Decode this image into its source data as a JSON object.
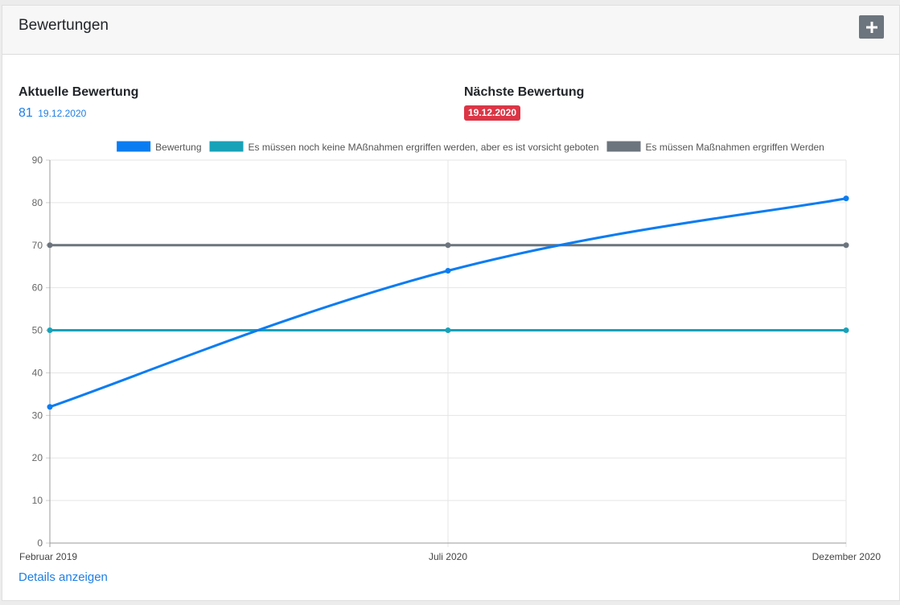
{
  "header": {
    "title": "Bewertungen",
    "add_icon": "plus-icon"
  },
  "current": {
    "label": "Aktuelle Bewertung",
    "value": "81",
    "date": "19.12.2020"
  },
  "next": {
    "label": "Nächste Bewertung",
    "date": "19.12.2020"
  },
  "footer": {
    "details_link": "Details anzeigen"
  },
  "colors": {
    "accent": "#1e7fe3",
    "danger": "#dc3545",
    "teal": "#17a2b8",
    "gray": "#6c757d"
  },
  "chart_data": {
    "type": "line",
    "categories": [
      "Februar 2019",
      "Juli 2020",
      "Dezember 2020"
    ],
    "ylim": [
      0,
      90
    ],
    "yticks": [
      0,
      10,
      20,
      30,
      40,
      50,
      60,
      70,
      80,
      90
    ],
    "grid": true,
    "legend_position": "top",
    "series": [
      {
        "name": "Bewertung",
        "values": [
          32,
          64,
          81
        ],
        "color": "#0a7cf2",
        "curved": true
      },
      {
        "name": "Es müssen noch keine MAßnahmen ergriffen werden, aber es ist vorsicht geboten",
        "values": [
          50,
          50,
          50
        ],
        "color": "#17a2b8"
      },
      {
        "name": "Es müssen Maßnahmen ergriffen Werden",
        "values": [
          70,
          70,
          70
        ],
        "color": "#6c757d"
      }
    ]
  }
}
